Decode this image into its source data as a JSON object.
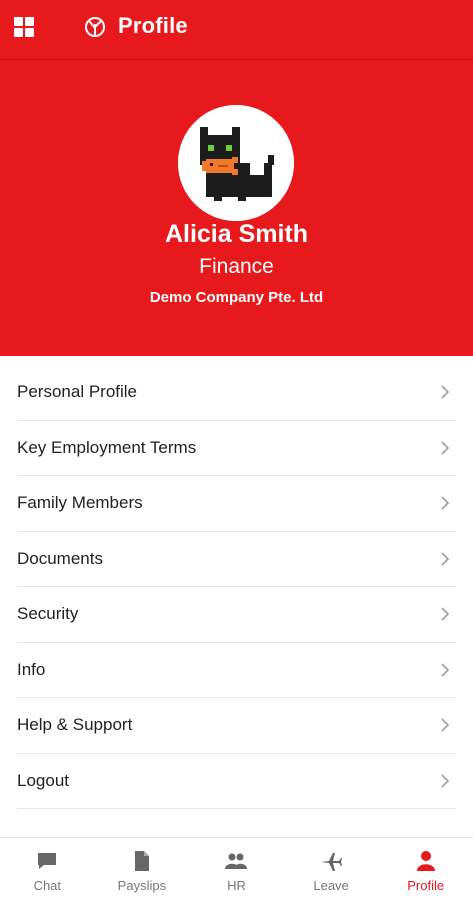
{
  "header": {
    "title": "Profile",
    "menu_icon": "grid-menu-icon",
    "logo_icon": "tree-logo-icon",
    "background_color": "#e8191d"
  },
  "profile": {
    "name": "Alicia Smith",
    "department": "Finance",
    "company": "Demo Company Pte. Ltd",
    "avatar": "cat-avatar"
  },
  "menu": {
    "items": [
      {
        "label": "Personal Profile"
      },
      {
        "label": "Key Employment Terms"
      },
      {
        "label": "Family Members"
      },
      {
        "label": "Documents"
      },
      {
        "label": "Security"
      },
      {
        "label": "Info"
      },
      {
        "label": "Help & Support"
      },
      {
        "label": "Logout"
      }
    ],
    "chevron_icon": "chevron-right-icon"
  },
  "bottom_nav": {
    "active": "Profile",
    "active_color": "#e8191d",
    "items": [
      {
        "label": "Chat",
        "icon": "chat-icon"
      },
      {
        "label": "Payslips",
        "icon": "document-icon"
      },
      {
        "label": "HR",
        "icon": "people-icon"
      },
      {
        "label": "Leave",
        "icon": "airplane-icon"
      },
      {
        "label": "Profile",
        "icon": "person-icon"
      }
    ]
  }
}
